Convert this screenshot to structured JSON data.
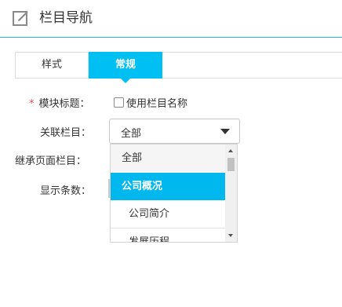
{
  "header": {
    "title": "栏目导航",
    "icon": "edit-icon",
    "border_color": "#29b6d8"
  },
  "tabs": [
    {
      "label": "样式",
      "active": false
    },
    {
      "label": "常规",
      "active": true
    }
  ],
  "accent_color": "#00bff3",
  "form": {
    "module_title": {
      "required_mark": "*",
      "label": "模块标题：",
      "checkbox_label": "使用栏目名称",
      "checked": false
    },
    "linked_column": {
      "label": "关联栏目：",
      "selected": "全部",
      "options": [
        "全部",
        "公司概况",
        "公司简介",
        "发展历程"
      ],
      "highlighted_option": "公司概况"
    },
    "inherit_page_column": {
      "label": "继承页面栏目："
    },
    "display_count": {
      "label": "显示条数："
    }
  }
}
